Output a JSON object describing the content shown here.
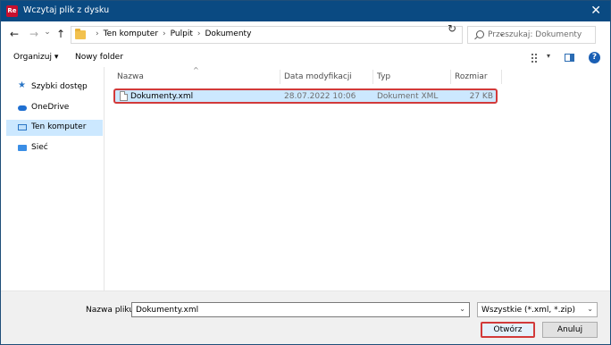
{
  "window": {
    "title": "Wczytaj plik z dysku",
    "app_icon_text": "Re",
    "accent": "#0a4a82"
  },
  "nav": {
    "back": "←",
    "forward": "→",
    "recent": "⌄",
    "up": "↑",
    "breadcrumb": [
      "Ten komputer",
      "Pulpit",
      "Dokumenty"
    ],
    "search_placeholder": "Przeszukaj: Dokumenty"
  },
  "toolbar": {
    "organize": "Organizuj",
    "new_folder": "Nowy folder"
  },
  "sidebar": {
    "items": [
      {
        "label": "Szybki dostęp",
        "icon": "star-icon"
      },
      {
        "label": "OneDrive",
        "icon": "cloud-icon"
      },
      {
        "label": "Ten komputer",
        "icon": "pc-icon",
        "selected": true
      },
      {
        "label": "Sieć",
        "icon": "network-icon"
      }
    ]
  },
  "columns": [
    "Nazwa",
    "Data modyfikacji",
    "Typ",
    "Rozmiar"
  ],
  "files": [
    {
      "name": "Dokumenty.xml",
      "modified": "28.07.2022 10:06",
      "type": "Dokument XML",
      "size": "27 KB",
      "selected": true
    }
  ],
  "footer": {
    "filename_label": "Nazwa pliku:",
    "filename_value": "Dokumenty.xml",
    "filter": "Wszystkie (*.xml, *.zip)",
    "open_label": "Otwórz",
    "cancel_label": "Anuluj",
    "highlight": "#d23a3a"
  }
}
